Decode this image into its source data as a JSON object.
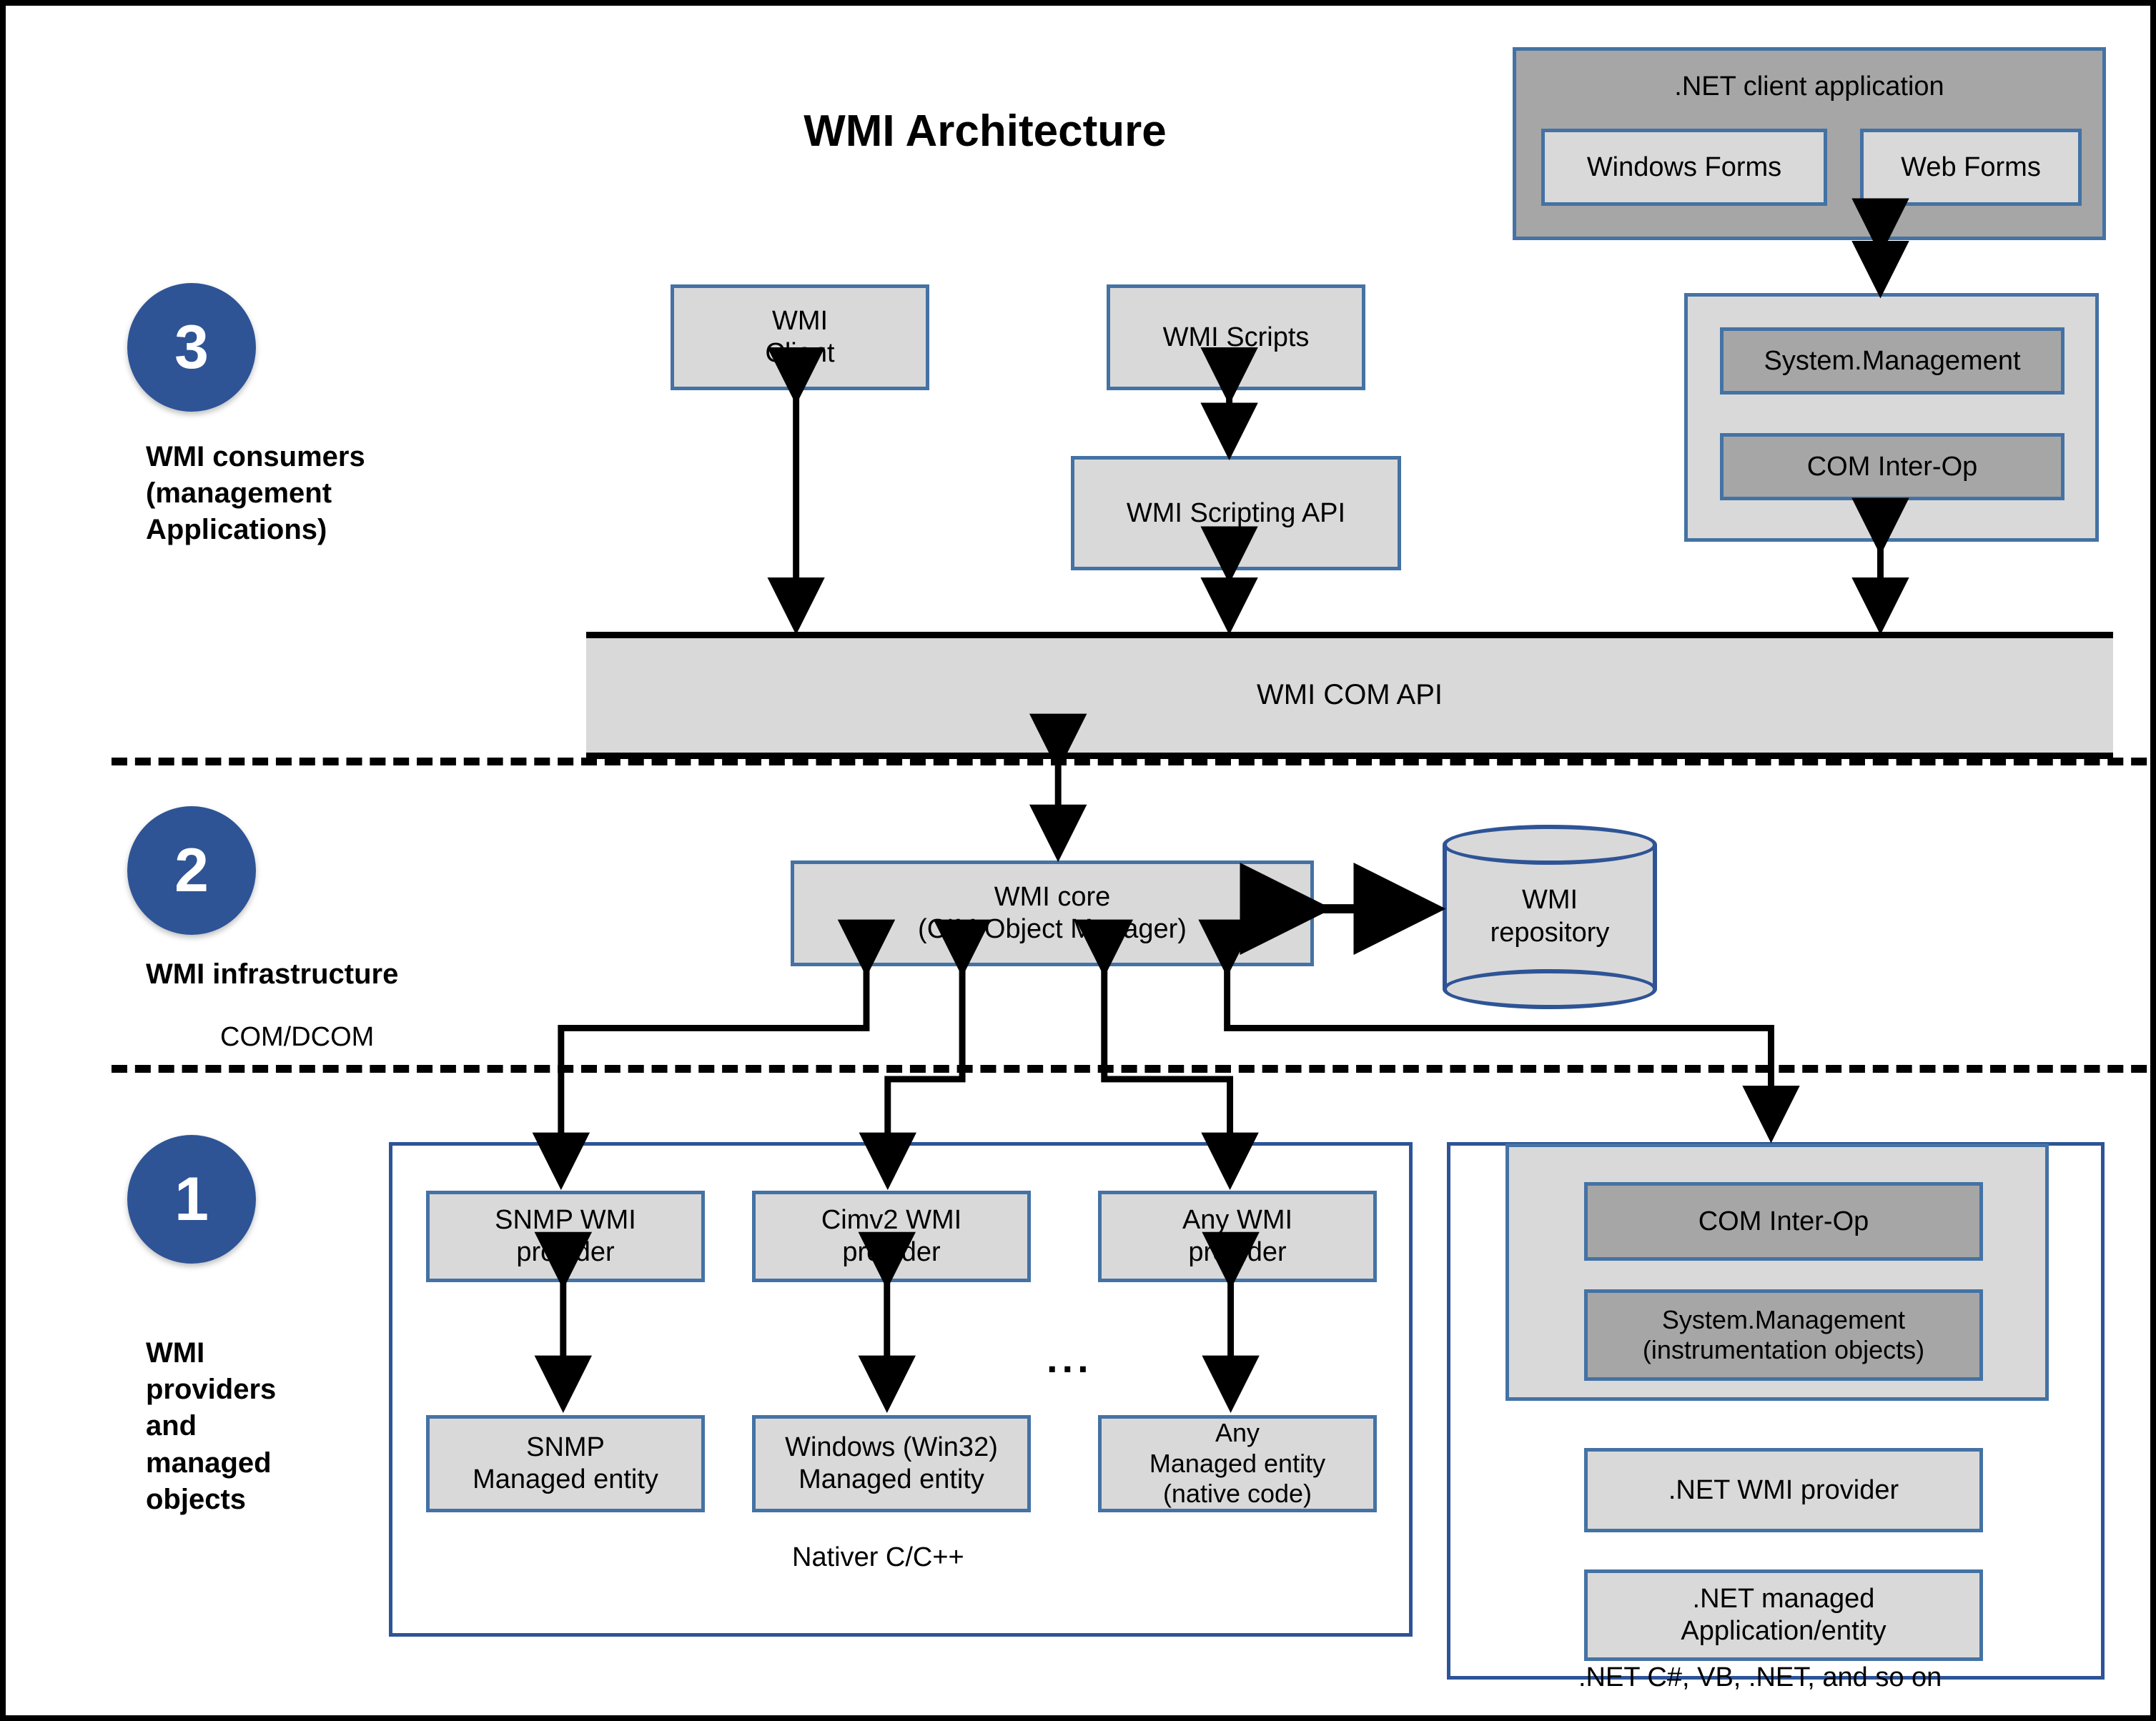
{
  "title": "WMI Architecture",
  "layers": [
    {
      "number": "3",
      "label": "WMI consumers\n(management\nApplications)"
    },
    {
      "number": "2",
      "label": "WMI infrastructure"
    },
    {
      "number": "1",
      "label": "WMI\nproviders\nand\nmanaged\nobjects"
    }
  ],
  "boundary_labels": {
    "com_dcom": "COM/DCOM"
  },
  "consumers": {
    "dotnet_client_application": {
      "title": ".NET client application",
      "windows_forms": "Windows Forms",
      "web_forms": "Web Forms"
    },
    "wmi_client": "WMI\nClient",
    "wmi_scripts": "WMI Scripts",
    "wmi_scripting_api": "WMI Scripting API",
    "managed_stack": {
      "system_management": "System.Management",
      "com_interop": "COM Inter-Op"
    },
    "wmi_com_api": "WMI COM API"
  },
  "infrastructure": {
    "wmi_core": "WMI core\n(CIM Object Manager)",
    "wmi_repository": "WMI\nrepository"
  },
  "providers": {
    "native_group": {
      "footer": "Nativer C/C++",
      "ellipsis": "...",
      "columns": [
        {
          "provider": "SNMP WMI\nprovider",
          "entity": "SNMP\nManaged entity"
        },
        {
          "provider": "Cimv2 WMI\nprovider",
          "entity": "Windows (Win32)\nManaged entity"
        },
        {
          "provider": "Any WMI\nprovider",
          "entity": "Any\nManaged entity\n(native code)"
        }
      ]
    },
    "dotnet_group": {
      "footer": ".NET C#, VB, .NET, and so on",
      "com_interop": "COM Inter-Op",
      "system_management": "System.Management\n(instrumentation objects)",
      "dotnet_wmi_provider": ".NET WMI provider",
      "dotnet_managed_application": ".NET managed\nApplication/entity"
    }
  },
  "colors": {
    "accent_blue": "#2e5496",
    "border_blue": "#4472a4",
    "fill_light": "#d9d9d9",
    "fill_dark": "#a6a6a6",
    "frame": "#000000"
  }
}
